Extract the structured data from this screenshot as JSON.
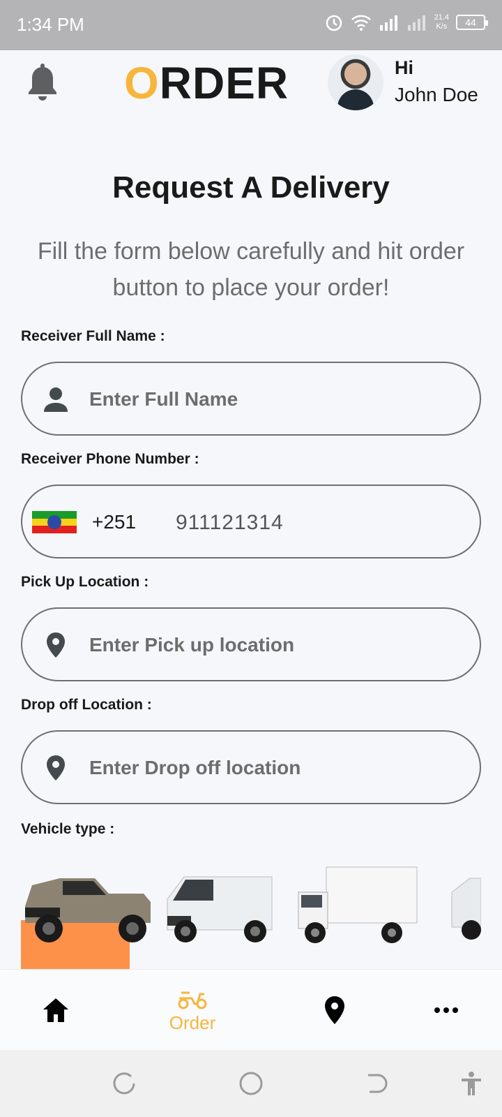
{
  "status": {
    "time": "1:34 PM",
    "speed_top": "21.4",
    "speed_bottom": "K/s",
    "battery": "44"
  },
  "header": {
    "logo_first": "O",
    "logo_rest": "RDER",
    "greeting": "Hi",
    "user_name": "John Doe"
  },
  "page": {
    "title": "Request A Delivery",
    "subtitle": "Fill the form below carefully and hit order button to place your order!"
  },
  "form": {
    "receiver_name_label": "Receiver Full Name :",
    "receiver_name_placeholder": "Enter Full Name",
    "receiver_phone_label": "Receiver Phone Number :",
    "dial_code": "+251",
    "phone_value": "911121314",
    "pickup_label": "Pick Up Location :",
    "pickup_placeholder": "Enter Pick up location",
    "dropoff_label": "Drop off Location :",
    "dropoff_placeholder": "Enter Drop off location",
    "vehicle_label": "Vehicle type :"
  },
  "vehicles": [
    {
      "name": "pickup-truck",
      "selected": true
    },
    {
      "name": "van",
      "selected": false
    },
    {
      "name": "box-truck",
      "selected": false
    },
    {
      "name": "van-partial",
      "selected": false
    }
  ],
  "nav": {
    "items": [
      {
        "icon": "home-icon",
        "label": ""
      },
      {
        "icon": "scooter-icon",
        "label": "Order",
        "active": true
      },
      {
        "icon": "location-pin-icon",
        "label": ""
      },
      {
        "icon": "more-icon",
        "label": ""
      }
    ]
  },
  "colors": {
    "accent": "#f7b53c",
    "selected_vehicle_bg": "#fd914a",
    "background": "#f6f7fa"
  }
}
